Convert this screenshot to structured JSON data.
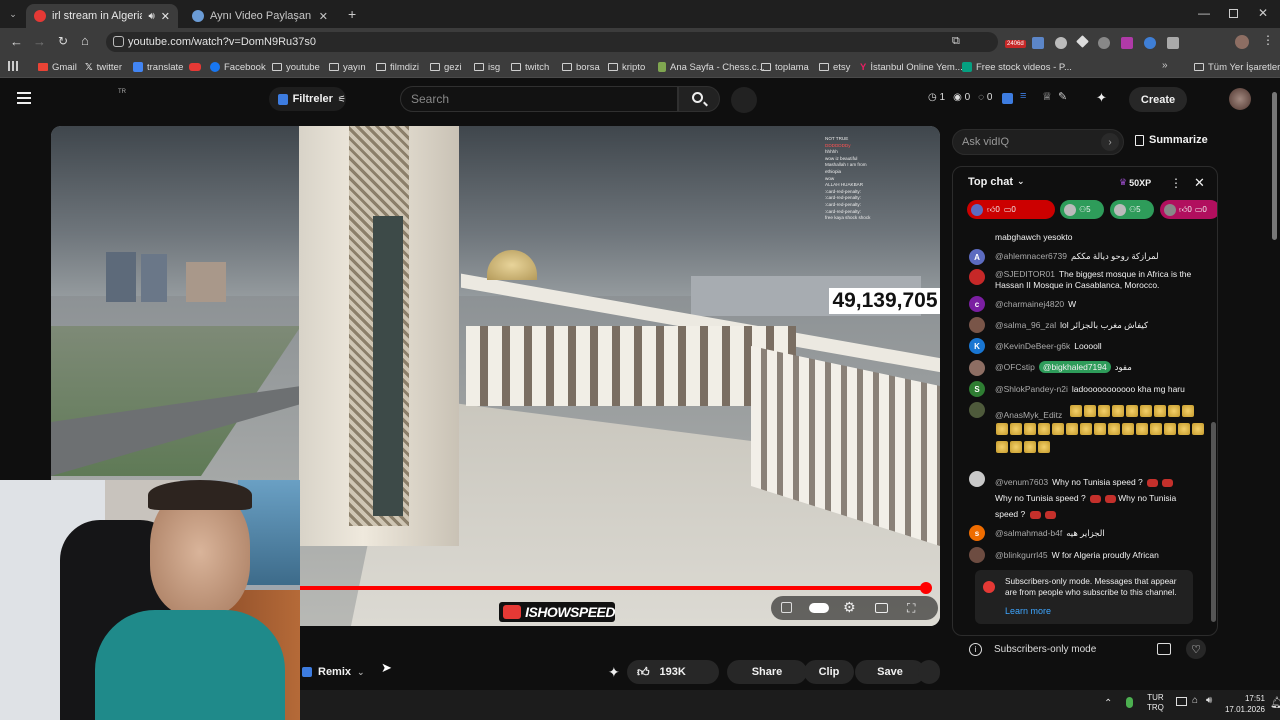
{
  "browser": {
    "tabs": [
      {
        "title": "irl stream in Algeria oz - Yo",
        "active": true
      },
      {
        "title": "Aynı Video Paylaşan Sayfa",
        "active": false
      }
    ],
    "url": "youtube.com/watch?v=DomN9Ru37s0",
    "bookmarks": [
      "Gmail",
      "twitter",
      "translate",
      "Facebook",
      "youtube",
      "yayın",
      "filmdizi",
      "gezi",
      "isg",
      "twitch",
      "borsa",
      "kripto",
      "Ana Sayfa - Chess.c...",
      "toplama",
      "etsy",
      "İstanbul Online Yem...",
      "Free stock videos - P..."
    ],
    "bookmarks_right": "Tüm Yer İşaretleri",
    "ext_badge": "2406d"
  },
  "youtube": {
    "country": "TR",
    "filter_label": "Filtreler",
    "search_placeholder": "Search",
    "stats": [
      "1",
      "0",
      "0"
    ],
    "create_label": "Create"
  },
  "video": {
    "counter": "49,139,705",
    "watermark": "ISHOWSPEED",
    "progress": 0.99,
    "overlay_chat": [
      "NOT TRUE",
      "DDDDDDDy",
      "hhhhh",
      "wow iz beautiful",
      "Mashallah I am from",
      "ethiopia",
      "wow",
      "ALLAH HUAKBAR",
      ":card-red-penalty:",
      ":card-red-penalty:",
      ":card-red-penalty:",
      ":card-red-penalty:",
      "free kaya shock shock"
    ]
  },
  "actions": {
    "remix": "Remix",
    "likes": "193K",
    "share": "Share",
    "clip": "Clip",
    "save": "Save"
  },
  "sidepanel": {
    "ask_placeholder": "Ask vidIQ",
    "summarize": "Summarize",
    "chat_mode": "Top chat",
    "xp": "50XP",
    "chips": [
      "0",
      "0",
      "5",
      "5",
      "0",
      "0"
    ],
    "messages": [
      {
        "author": "",
        "text": "mabghawch yesokto",
        "avatar": "",
        "color": "#555"
      },
      {
        "author": "@ahlemnacer6739",
        "text": "لمرازكة روحو ديالة مككم",
        "avatar": "A",
        "color": "#5c6bc0"
      },
      {
        "author": "@SJEDITOR01",
        "text": "The biggest mosque in Africa is the Hassan II Mosque in Casablanca, Morocco.",
        "avatar": "",
        "color": "#c62828"
      },
      {
        "author": "@charmainej4820",
        "text": "W",
        "avatar": "c",
        "color": "#7b1fa2"
      },
      {
        "author": "@salma_96_zal",
        "text": "lol كيفاش مغرب بالجزائر",
        "avatar": "",
        "color": "#795548"
      },
      {
        "author": "@KevinDeBeer-g6k",
        "text": "Looooll",
        "avatar": "K",
        "color": "#1976d2"
      },
      {
        "author": "@OFCstip",
        "text": "مفود",
        "mention": "@bigkhaled7194",
        "avatar": "",
        "color": "#8d6e63"
      },
      {
        "author": "@ShlokPandey-n2i",
        "text": "ladooooooooooo kha mg haru",
        "avatar": "S",
        "color": "#2e7d32"
      },
      {
        "author": "@AnasMyk_Editz",
        "text": "",
        "avatar": "",
        "color": "#4e5a3b"
      },
      {
        "author": "@venum7603",
        "text": "Why no Tunisia speed ?",
        "line2": "Why no Tunisia speed ?",
        "line2b": "Why no Tunisia",
        "line3": "speed ?",
        "avatar": "",
        "color": "#c8c8c8"
      },
      {
        "author": "@salmahmad-b4f",
        "text": "الجزاير هيه",
        "avatar": "s",
        "color": "#ef6c00"
      },
      {
        "author": "@blinkgurrl45",
        "text": "W for Algeria proudly African",
        "avatar": "",
        "color": "#6d4c41"
      }
    ],
    "notice_text": "Subscribers-only mode. Messages that appear are from people who subscribe to this channel.",
    "learn_more": "Learn more",
    "footer": "Subscribers-only mode"
  },
  "taskbar": {
    "lang1": "TUR",
    "lang2": "TRQ",
    "time": "17:51",
    "date": "17.01.2026"
  }
}
